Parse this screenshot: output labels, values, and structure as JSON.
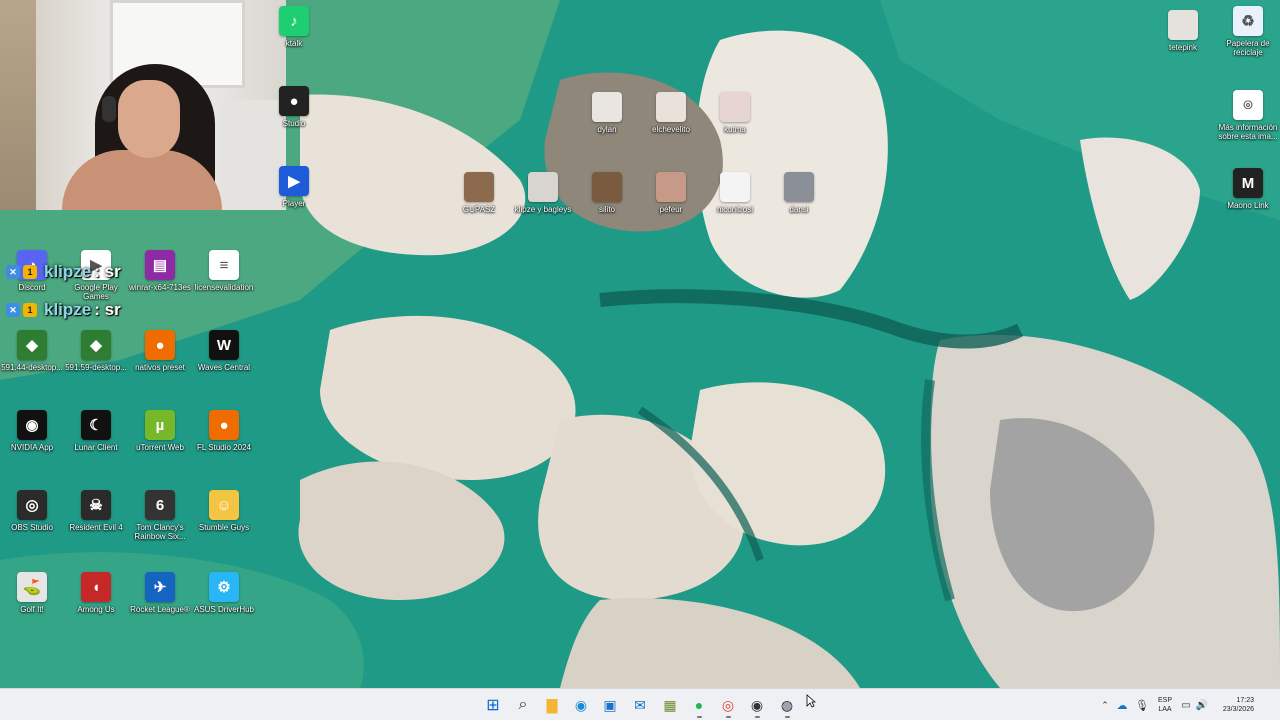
{
  "desktop": {
    "icons": [
      {
        "id": "tiktok",
        "label": "ktalk",
        "color": "#1dcf70",
        "glyph": "♪"
      },
      {
        "id": "obs-left",
        "label": "Studio",
        "color": "#222",
        "glyph": "●"
      },
      {
        "id": "player",
        "label": "Player",
        "color": "#1e5bd8",
        "glyph": "▶"
      },
      {
        "id": "dylan",
        "label": "dylan",
        "color": "#e9e6e1",
        "glyph": ""
      },
      {
        "id": "elchevelito",
        "label": "elchevelito",
        "color": "#e8e2da",
        "glyph": ""
      },
      {
        "id": "kutma",
        "label": "kutma",
        "color": "#e6d5d2",
        "glyph": ""
      },
      {
        "id": "gupasz",
        "label": "GUPASZ",
        "color": "#8b6a4e",
        "glyph": ""
      },
      {
        "id": "klipze",
        "label": "klipze y bagleys",
        "color": "#d8d4cf",
        "glyph": ""
      },
      {
        "id": "silito",
        "label": "silito",
        "color": "#7a5b3f",
        "glyph": ""
      },
      {
        "id": "pefeur",
        "label": "pefeur",
        "color": "#c79a87",
        "glyph": ""
      },
      {
        "id": "niconitrosi",
        "label": "niconitrosi",
        "color": "#f4f4f4",
        "glyph": ""
      },
      {
        "id": "dansi",
        "label": "dansi",
        "color": "#8b8f97",
        "glyph": ""
      },
      {
        "id": "discord",
        "label": "Discord",
        "color": "#5865f2",
        "glyph": "◕"
      },
      {
        "id": "googleplay",
        "label": "Google Play Games",
        "color": "#ffffff",
        "glyph": "▶"
      },
      {
        "id": "winrar",
        "label": "winrar-x64-713es",
        "color": "#8e2aa6",
        "glyph": "▤"
      },
      {
        "id": "license",
        "label": "licensevalidation",
        "color": "#ffffff",
        "glyph": "≡"
      },
      {
        "id": "nvd1",
        "label": "591.44-desktop...",
        "color": "#2e7d32",
        "glyph": "◆"
      },
      {
        "id": "nvd2",
        "label": "591.59-desktop...",
        "color": "#2e7d32",
        "glyph": "◆"
      },
      {
        "id": "nativos",
        "label": "nativos preset",
        "color": "#ef6c00",
        "glyph": "●"
      },
      {
        "id": "waves",
        "label": "Waves Central",
        "color": "#111111",
        "glyph": "W"
      },
      {
        "id": "nvidia",
        "label": "NVIDIA App",
        "color": "#111111",
        "glyph": "◉"
      },
      {
        "id": "lunar",
        "label": "Lunar Client",
        "color": "#111111",
        "glyph": "☾"
      },
      {
        "id": "utorrent",
        "label": "uTorrent Web",
        "color": "#76b82a",
        "glyph": "µ"
      },
      {
        "id": "flstudio",
        "label": "FL Studio 2024",
        "color": "#ef6c00",
        "glyph": "●"
      },
      {
        "id": "obs",
        "label": "OBS Studio",
        "color": "#2b2b2b",
        "glyph": "◎"
      },
      {
        "id": "re4",
        "label": "Resident Evil 4",
        "color": "#2a2a2a",
        "glyph": "☠"
      },
      {
        "id": "r6",
        "label": "Tom Clancy's Rainbow Six...",
        "color": "#333333",
        "glyph": "6"
      },
      {
        "id": "stumble",
        "label": "Stumble Guys",
        "color": "#f4c542",
        "glyph": "☺"
      },
      {
        "id": "golfit",
        "label": "Golf It!",
        "color": "#e5e5e5",
        "glyph": "⛳"
      },
      {
        "id": "amongus",
        "label": "Among Us",
        "color": "#c62828",
        "glyph": "◖"
      },
      {
        "id": "rocket",
        "label": "Rocket League®",
        "color": "#1565c0",
        "glyph": "✈"
      },
      {
        "id": "asus",
        "label": "ASUS DriverHub",
        "color": "#29b6f6",
        "glyph": "⚙"
      },
      {
        "id": "tetepink",
        "label": "tetepink",
        "color": "#e5e1dc",
        "glyph": ""
      },
      {
        "id": "recycle",
        "label": "Papelera de reciclaje",
        "color": "#e9f2fa",
        "glyph": "♻"
      },
      {
        "id": "spotlight",
        "label": "Más información sobre esta ima...",
        "color": "#ffffff",
        "glyph": "⌾"
      },
      {
        "id": "maono",
        "label": "Maono Link",
        "color": "#222222",
        "glyph": "M"
      }
    ]
  },
  "chat": [
    {
      "name": "klipze",
      "message": ": sr"
    },
    {
      "name": "klipze",
      "message": ": sr"
    }
  ],
  "taskbar": {
    "apps": [
      {
        "id": "start",
        "glyph": "⊞",
        "color": "#0a64d8"
      },
      {
        "id": "search",
        "glyph": "⌕",
        "color": "#333333"
      },
      {
        "id": "explorer",
        "glyph": "▇",
        "color": "#f2b631"
      },
      {
        "id": "edge",
        "glyph": "◉",
        "color": "#1c8bd6"
      },
      {
        "id": "store",
        "glyph": "▣",
        "color": "#1a73c9"
      },
      {
        "id": "outlook",
        "glyph": "✉",
        "color": "#0f6cbd"
      },
      {
        "id": "minecraft",
        "glyph": "▦",
        "color": "#6b8b2f"
      },
      {
        "id": "spotify",
        "glyph": "●",
        "color": "#1db954"
      },
      {
        "id": "chrome",
        "glyph": "◎",
        "color": "#db4437"
      },
      {
        "id": "obs-task",
        "glyph": "◉",
        "color": "#333333"
      },
      {
        "id": "steam",
        "glyph": "◍",
        "color": "#1b2838"
      }
    ],
    "tray": {
      "lang_top": "ESP",
      "lang_bottom": "LAA",
      "time": "17:23",
      "date": "23/3/2026"
    }
  }
}
